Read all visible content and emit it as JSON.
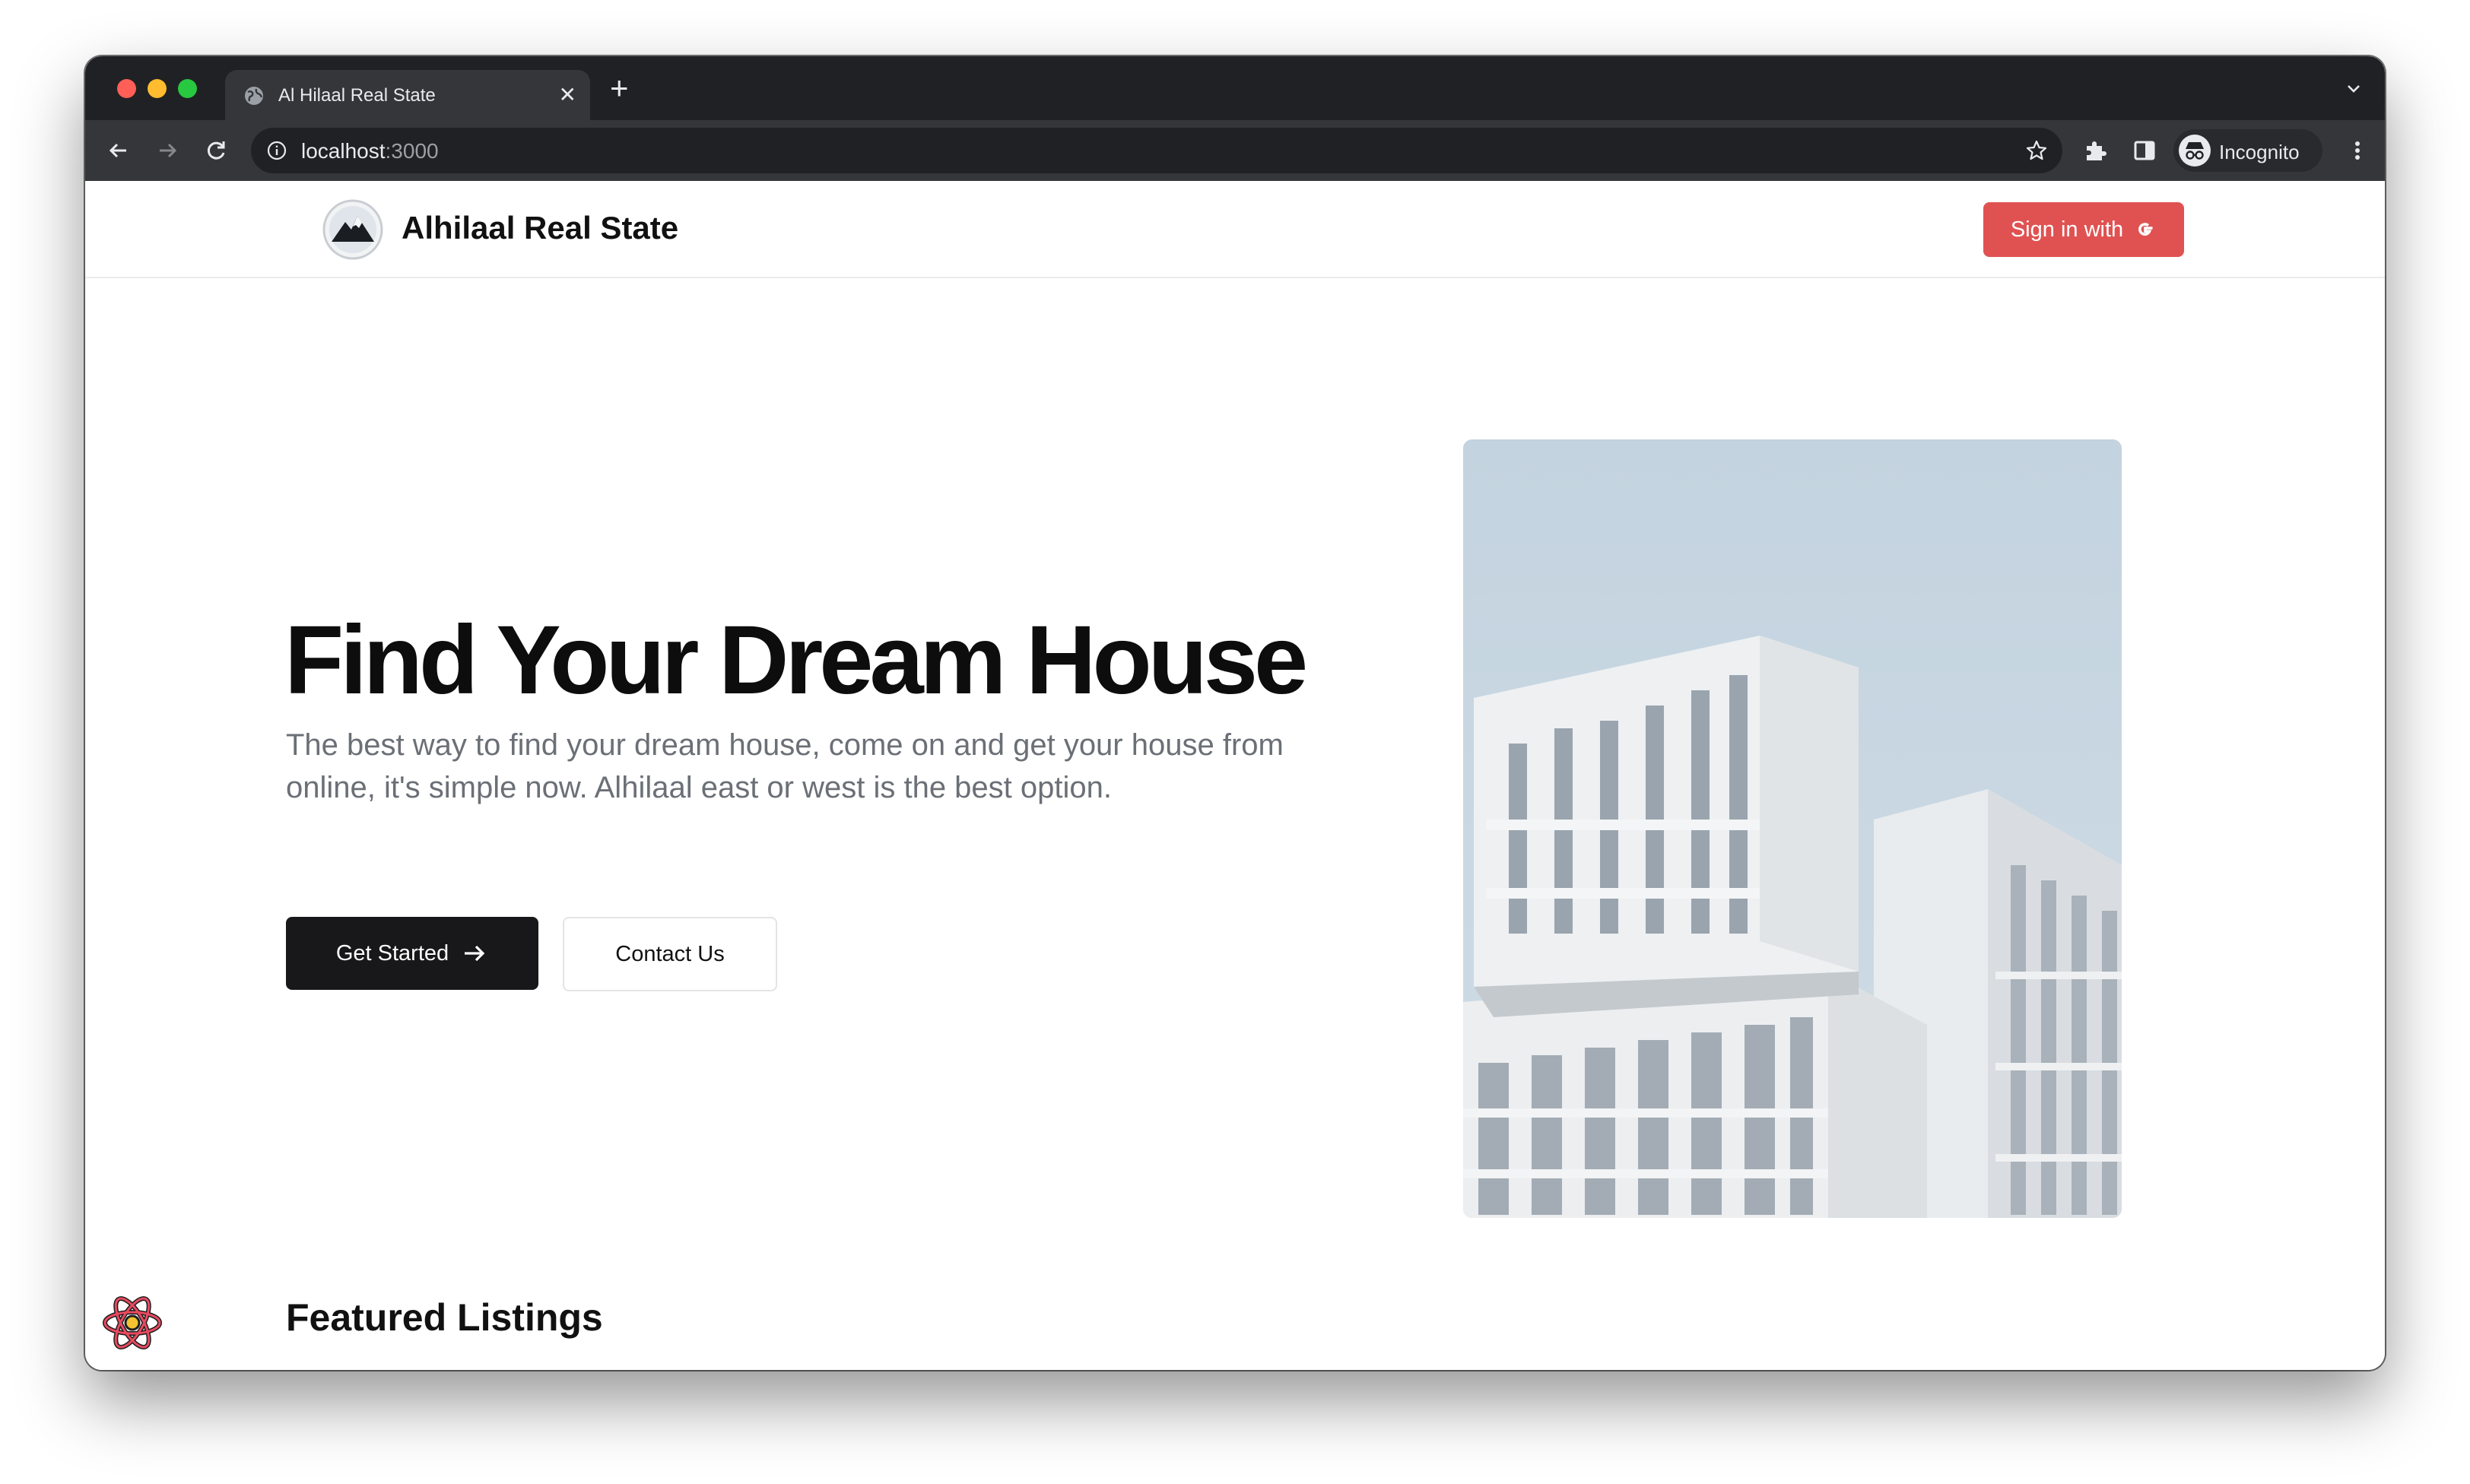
{
  "browser": {
    "tab_title": "Al Hilaal Real State",
    "url_host": "localhost",
    "url_port": ":3000",
    "profile_label": "Incognito"
  },
  "header": {
    "brand": "Alhilaal Real State",
    "signin_label": "Sign in with",
    "signin_icon": "google-g-icon"
  },
  "hero": {
    "title": "Find Your Dream House",
    "description": "The best way to find your dream house, come on and get your house from online, it's simple now. Alhilaal east or west is the best option.",
    "primary_cta": "Get Started",
    "secondary_cta": "Contact Us"
  },
  "featured": {
    "title": "Featured Listings"
  },
  "colors": {
    "accent_red": "#e05252",
    "dark_button": "#18181a",
    "chrome_dark": "#202124",
    "chrome_toolbar": "#35363a"
  }
}
